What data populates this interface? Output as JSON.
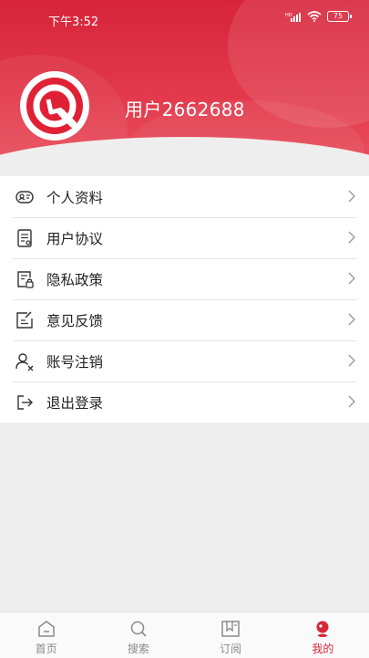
{
  "status_bar": {
    "time": "下午3:52",
    "battery": "75"
  },
  "profile": {
    "username": "用户2662688"
  },
  "menu": [
    {
      "label": "个人资料",
      "icon": "id-card-icon"
    },
    {
      "label": "用户协议",
      "icon": "document-icon"
    },
    {
      "label": "隐私政策",
      "icon": "privacy-lock-icon"
    },
    {
      "label": "意见反馈",
      "icon": "feedback-edit-icon"
    },
    {
      "label": "账号注销",
      "icon": "user-remove-icon"
    },
    {
      "label": "退出登录",
      "icon": "logout-icon"
    }
  ],
  "bottom_nav": [
    {
      "label": "首页",
      "icon": "home-icon",
      "active": false
    },
    {
      "label": "搜索",
      "icon": "search-icon",
      "active": false
    },
    {
      "label": "订阅",
      "icon": "subscribe-icon",
      "active": false
    },
    {
      "label": "我的",
      "icon": "profile-icon",
      "active": true
    }
  ],
  "colors": {
    "brand": "#d8273b",
    "background": "#efeeee"
  }
}
